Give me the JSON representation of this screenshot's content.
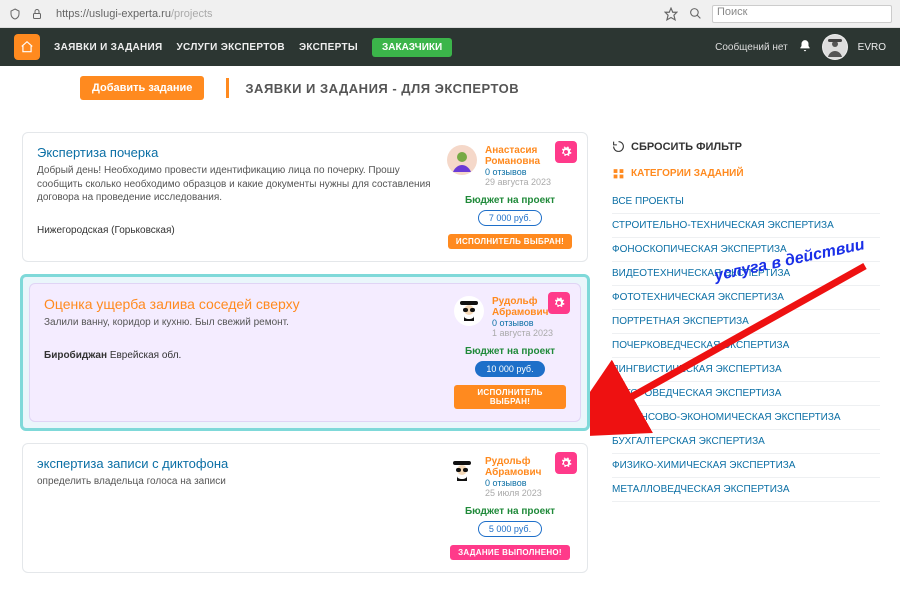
{
  "browser": {
    "url_host": "https://uslugi-experta.ru",
    "url_path": "/projects",
    "search_placeholder": "Поиск"
  },
  "nav": {
    "items": [
      "ЗАЯВКИ И ЗАДАНИЯ",
      "УСЛУГИ ЭКСПЕРТОВ",
      "ЭКСПЕРТЫ"
    ],
    "cta": "ЗАКАЗЧИКИ",
    "no_messages": "Сообщений нет",
    "user": "EVRO"
  },
  "subheader": {
    "add_button": "Добавить задание",
    "title": "ЗАЯВКИ И ЗАДАНИЯ - ДЛЯ ЭКСПЕРТОВ"
  },
  "annotation": "услуга в действии",
  "cards": [
    {
      "title": "Экспертиза почерка",
      "desc": "Добрый день! Необходимо провести идентификацию лица по почерку. Прошу сообщить сколько необходимо образцов и какие документы нужны для составления договора на проведение исследования.",
      "location": "Нижегородская (Горьковская)",
      "author": {
        "name": "Анастасия Романовна",
        "reviews": "0 отзывов",
        "date": "29 августа 2023"
      },
      "budget_label": "Бюджет на проект",
      "price": "7 000 руб.",
      "status": "ИСПОЛНИТЕЛЬ ВЫБРАН!"
    },
    {
      "title": "Оценка ущерба залива соседей сверху",
      "desc": "Залили ванну, коридор и кухню. Был свежий ремонт.",
      "location_strong": "Биробиджан",
      "location_rest": " Еврейская обл.",
      "author": {
        "name": "Рудольф Абрамович",
        "reviews": "0 отзывов",
        "date": "1 августа 2023"
      },
      "budget_label": "Бюджет на проект",
      "price": "10 000 руб.",
      "status": "ИСПОЛНИТЕЛЬ ВЫБРАН!"
    },
    {
      "title": "экспертиза записи с диктофона",
      "desc": "определить владельца голоса на записи",
      "author": {
        "name": "Рудольф Абрамович",
        "reviews": "0 отзывов",
        "date": "25 июля 2023"
      },
      "budget_label": "Бюджет на проект",
      "price": "5 000 руб.",
      "status": "ЗАДАНИЕ ВЫПОЛНЕНО!"
    }
  ],
  "sidebar": {
    "reset": "СБРОСИТЬ ФИЛЬТР",
    "cat_header": "КАТЕГОРИИ ЗАДАНИЙ",
    "items": [
      "ВСЕ ПРОЕКТЫ",
      "СТРОИТЕЛЬНО-ТЕХНИЧЕСКАЯ ЭКСПЕРТИЗА",
      "ФОНОСКОПИЧЕСКАЯ ЭКСПЕРТИЗА",
      "ВИДЕОТЕХНИЧЕСКАЯ ЭКСПЕРТИЗА",
      "ФОТОТЕХНИЧЕСКАЯ ЭКСПЕРТИЗА",
      "ПОРТРЕТНАЯ ЭКСПЕРТИЗА",
      "ПОЧЕРКОВЕДЧЕСКАЯ ЭКСПЕРТИЗА",
      "ЛИНГВИСТИЧЕСКАЯ ЭКСПЕРТИЗА",
      "АВТОРОВЕДЧЕСКАЯ ЭКСПЕРТИЗА",
      "ФИНАНСОВО-ЭКОНОМИЧЕСКАЯ ЭКСПЕРТИЗА",
      "БУХГАЛТЕРСКАЯ ЭКСПЕРТИЗА",
      "ФИЗИКО-ХИМИЧЕСКАЯ ЭКСПЕРТИЗА",
      "МЕТАЛЛОВЕДЧЕСКАЯ ЭКСПЕРТИЗА"
    ]
  }
}
